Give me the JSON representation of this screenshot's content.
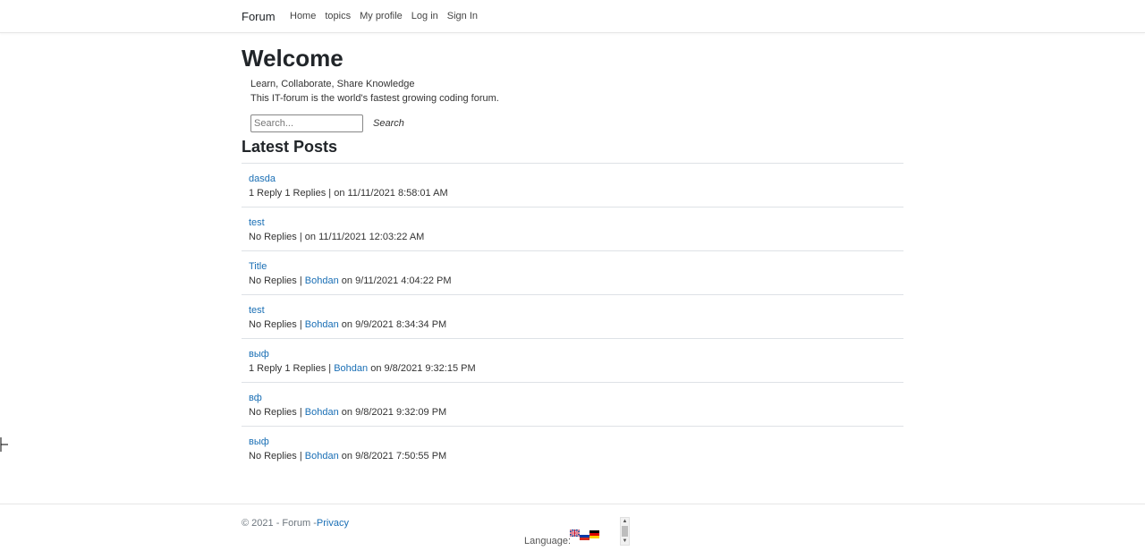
{
  "nav": {
    "brand": "Forum",
    "links": [
      "Home",
      "topics",
      "My profile",
      "Log in",
      "Sign In"
    ]
  },
  "hero": {
    "title": "Welcome",
    "tagline1": "Learn, Collaborate, Share Knowledge",
    "tagline2": "This IT-forum is the world's fastest growing coding forum."
  },
  "search": {
    "placeholder": "Search...",
    "button": "Search"
  },
  "latest": {
    "heading": "Latest Posts",
    "posts": [
      {
        "title": "dasda",
        "replies": "1 Reply 1 Replies",
        "sep": " | ",
        "author": "",
        "date": "on 11/11/2021 8:58:01 AM"
      },
      {
        "title": "test",
        "replies": "No Replies",
        "sep": " | ",
        "author": "",
        "date": "on 11/11/2021 12:03:22 AM"
      },
      {
        "title": "Title",
        "replies": "No Replies",
        "sep": " | ",
        "author": "Bohdan",
        "date": " on 9/11/2021 4:04:22 PM"
      },
      {
        "title": "test",
        "replies": "No Replies",
        "sep": " | ",
        "author": "Bohdan",
        "date": " on 9/9/2021 8:34:34 PM"
      },
      {
        "title": "выф",
        "replies": "1 Reply 1 Replies",
        "sep": " | ",
        "author": "Bohdan",
        "date": " on 9/8/2021 9:32:15 PM"
      },
      {
        "title": "вф",
        "replies": "No Replies",
        "sep": " | ",
        "author": "Bohdan",
        "date": " on 9/8/2021 9:32:09 PM"
      },
      {
        "title": "выф",
        "replies": "No Replies",
        "sep": " | ",
        "author": "Bohdan",
        "date": " on 9/8/2021 7:50:55 PM"
      }
    ]
  },
  "footer": {
    "copyright": "© 2021 - Forum -",
    "privacy": "Privacy",
    "language_label": "Language:"
  },
  "colors": {
    "link": "#1a6fb5",
    "text": "#212529"
  }
}
